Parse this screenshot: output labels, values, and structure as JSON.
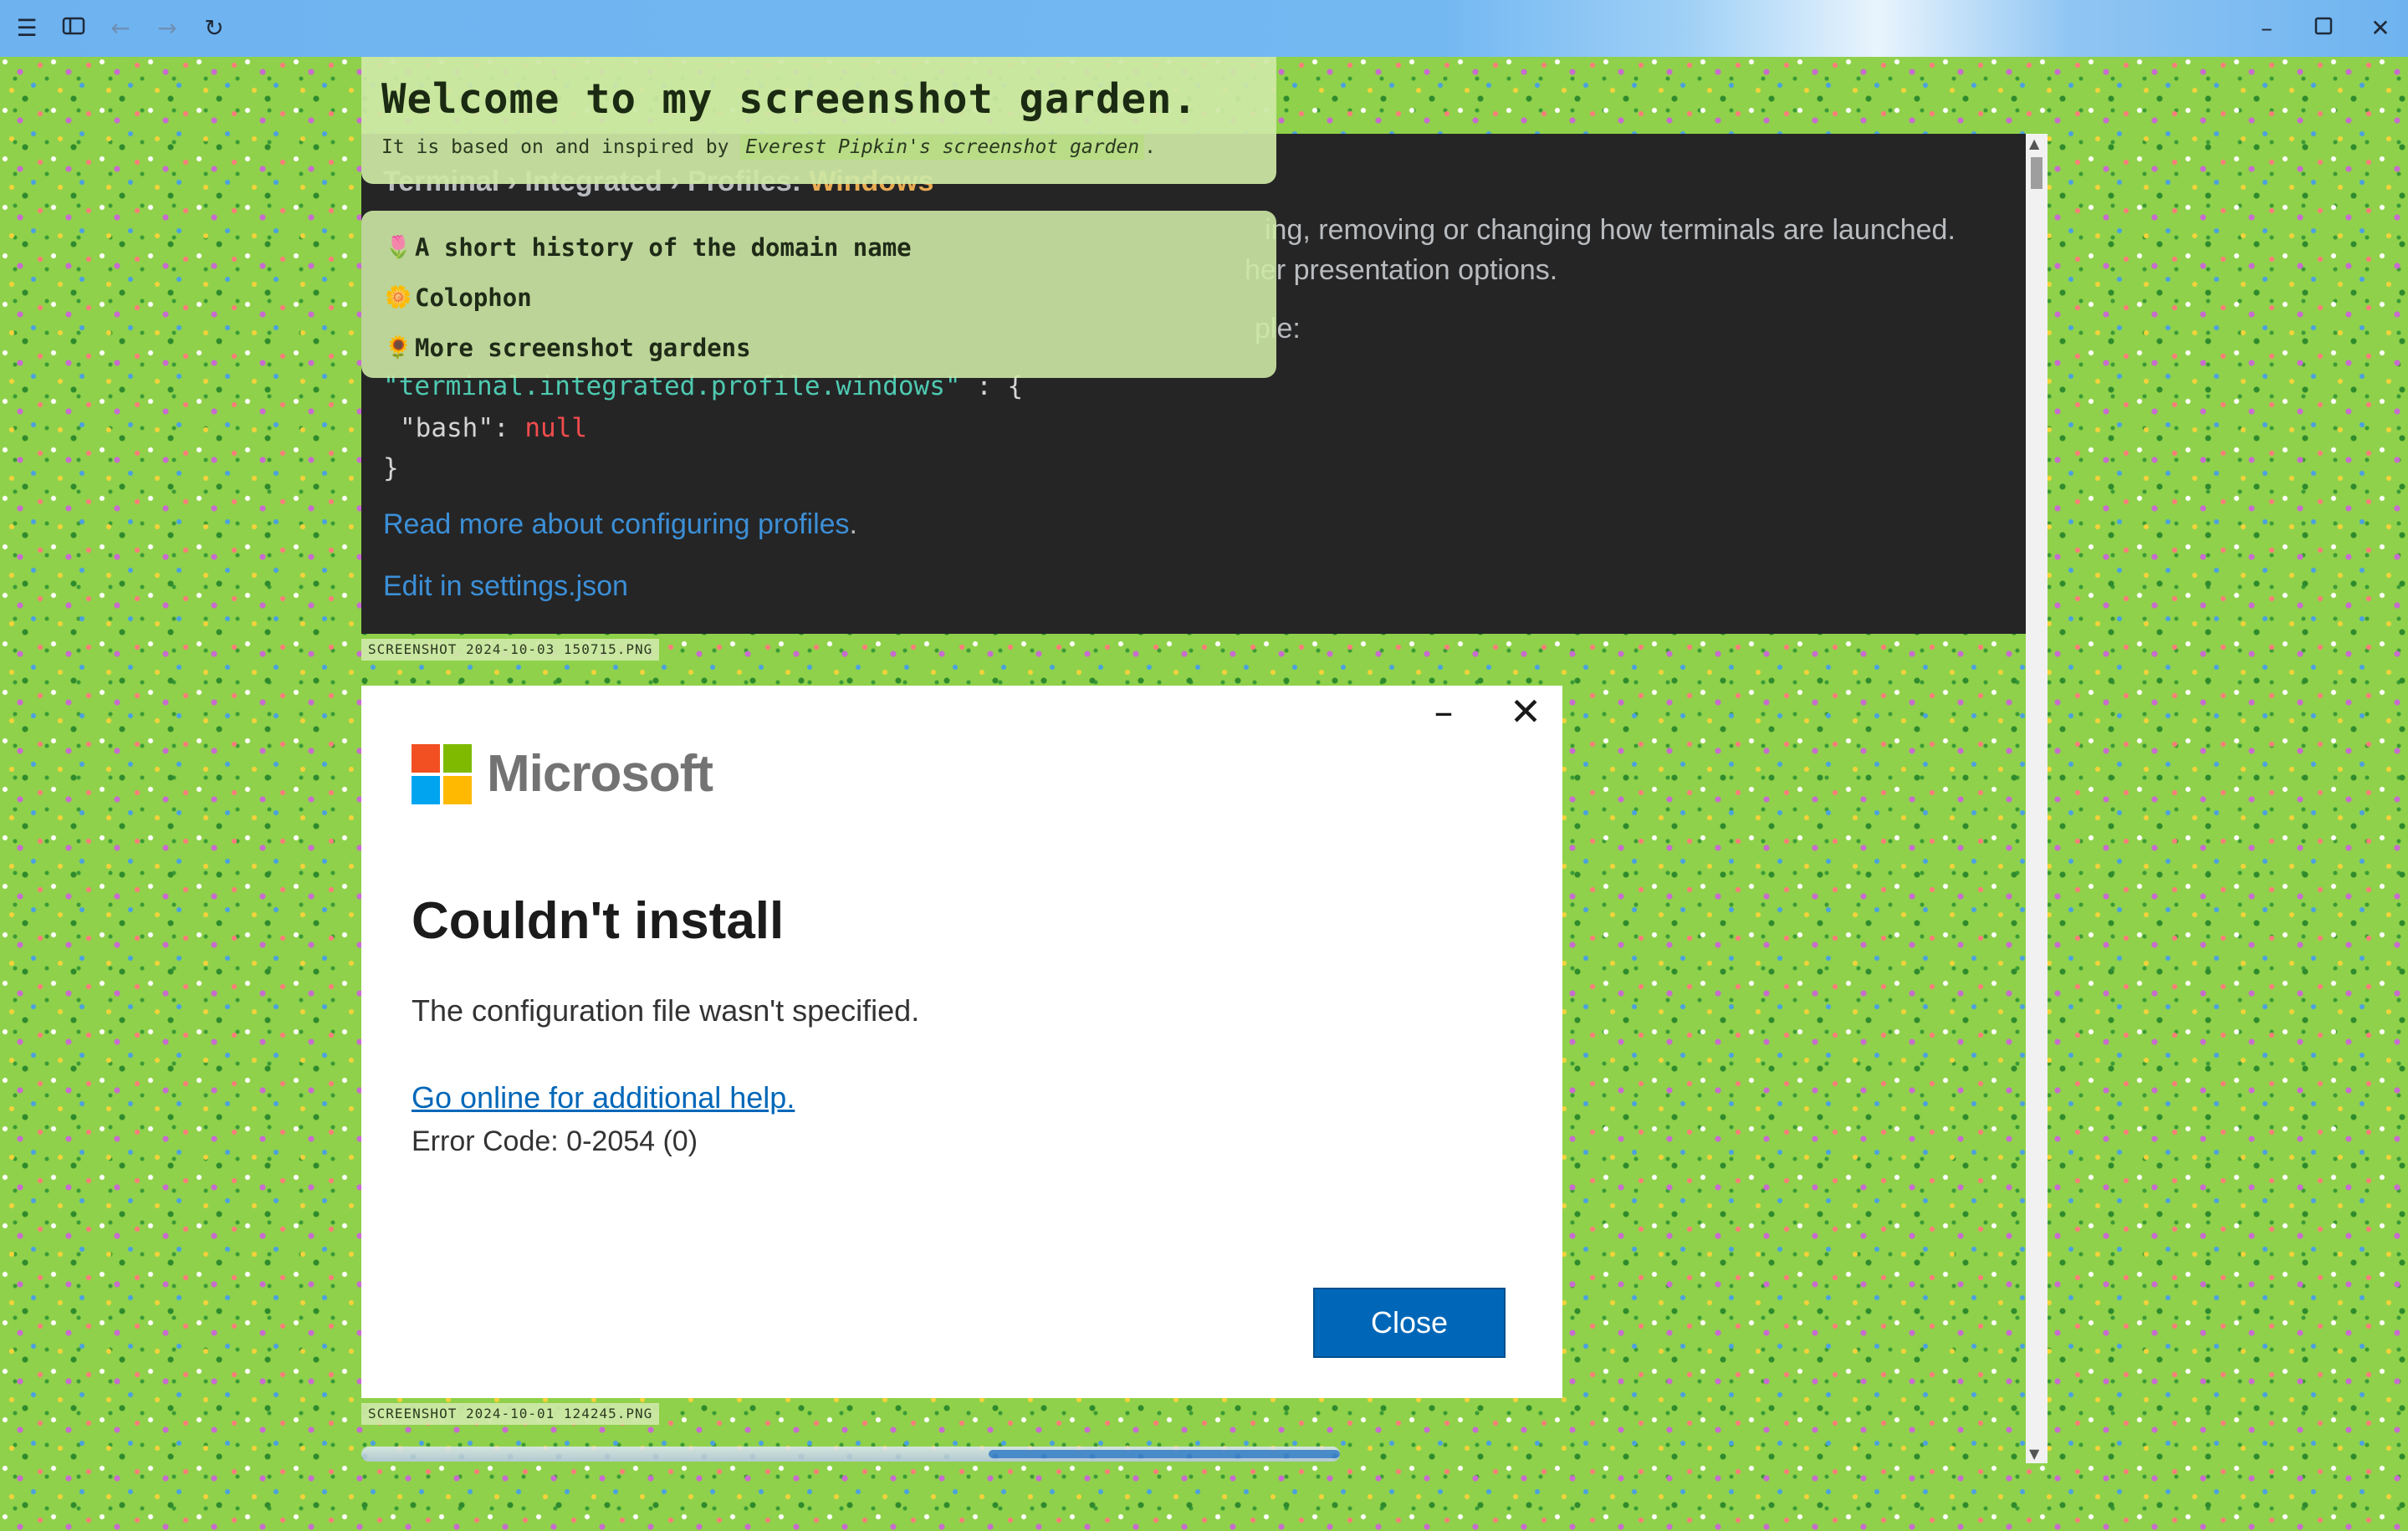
{
  "browser": {
    "icons": [
      "menu-icon",
      "sidebar-icon",
      "back-icon",
      "forward-icon",
      "reload-icon",
      "minimize-icon",
      "maximize-icon",
      "close-icon"
    ]
  },
  "welcome": {
    "title": "Welcome to my screenshot garden.",
    "subtitle_prefix": "It is based on and inspired by",
    "credit": "Everest Pipkin's screenshot garden",
    "subtitle_suffix": "."
  },
  "nav": {
    "items": [
      {
        "emoji": "🌷",
        "label": "A short history of the domain name"
      },
      {
        "emoji": "🌼",
        "label": "Colophon"
      },
      {
        "emoji": "🌻",
        "label": "More screenshot gardens"
      }
    ]
  },
  "screenshot1": {
    "breadcrumb_prefix": "Terminal › Integrated › Profiles:",
    "breadcrumb_highlight": "Windows",
    "line1_tail": "ing, removing or changing how terminals are launched.",
    "line2_tail": "her presentation options.",
    "line3_tail": "ple:",
    "code_key": "\"terminal.integrated.profile.windows\"",
    "code_brace": ": {",
    "code_line2_key": "\"bash\"",
    "code_line2_colon": ":",
    "code_line2_val": "null",
    "code_close": "}",
    "read_more": "Read more about configuring profiles",
    "read_more_period": ".",
    "edit_link": "Edit in settings.json",
    "caption": "SCREENSHOT 2024-10-03 150715.PNG"
  },
  "dialog": {
    "brand": "Microsoft",
    "title": "Couldn't install",
    "message": "The configuration file wasn't specified.",
    "help_link": "Go online for additional help.",
    "error_code": "Error Code: 0-2054 (0)",
    "close_label": "Close",
    "caption": "SCREENSHOT 2024-10-01 124245.PNG",
    "logo_colors": [
      "#f25022",
      "#7fba00",
      "#00a4ef",
      "#ffb900"
    ]
  }
}
